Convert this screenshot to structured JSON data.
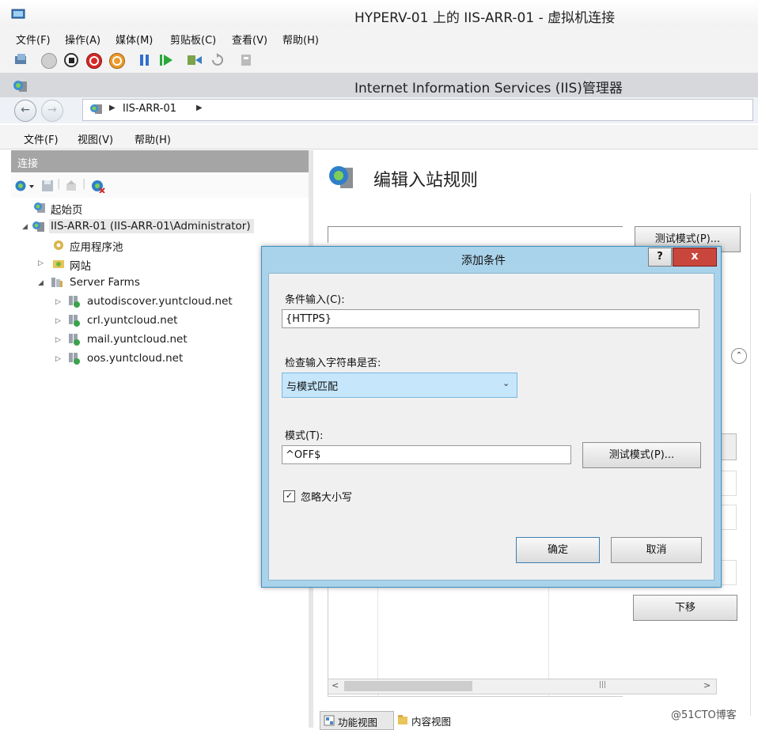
{
  "vm_window": {
    "title": "HYPERV-01 上的 IIS-ARR-01 - 虚拟机连接",
    "menu": [
      "文件(F)",
      "操作(A)",
      "媒体(M)",
      "剪贴板(C)",
      "查看(V)",
      "帮助(H)"
    ],
    "toolbar_icons": [
      "ctrl-alt-del-icon",
      "start-icon",
      "turn-off-icon",
      "shutdown-icon",
      "save-icon",
      "pause-icon",
      "resume-icon",
      "checkpoint-icon",
      "revert-icon",
      "enhanced-session-icon"
    ]
  },
  "iis": {
    "title": "Internet Information Services (IIS)管理器",
    "address": {
      "server": "IIS-ARR-01"
    },
    "menu": [
      "文件(F)",
      "视图(V)",
      "帮助(H)"
    ],
    "connections": {
      "header": "连接",
      "tree": [
        {
          "label": "起始页"
        },
        {
          "label": "IIS-ARR-01 (IIS-ARR-01\\Administrator)"
        },
        {
          "label": "应用程序池"
        },
        {
          "label": "网站"
        },
        {
          "label": "Server Farms"
        },
        {
          "label": "autodiscover.yuntcloud.net"
        },
        {
          "label": "crl.yuntcloud.net"
        },
        {
          "label": "mail.yuntcloud.net"
        },
        {
          "label": "oos.yuntcloud.net"
        }
      ]
    },
    "page": {
      "title": "编辑入站规则",
      "test_pattern_button": "测试模式(P)...",
      "move_down_button": "下移"
    },
    "bottom_tabs": [
      "功能视图",
      "内容视图"
    ]
  },
  "dialog": {
    "title": "添加条件",
    "help_label": "?",
    "close_label": "x",
    "condition_input_label": "条件输入(C):",
    "condition_input_value": "{HTTPS}",
    "check_label": "检查输入字符串是否:",
    "check_value": "与模式匹配",
    "pattern_label": "模式(T):",
    "pattern_value": "^OFF$",
    "test_button": "测试模式(P)...",
    "ignore_case_label": "忽略大小写",
    "ignore_case_checked": true,
    "ok_button": "确定",
    "cancel_button": "取消"
  },
  "watermark": "@51CTO博客",
  "colors": {
    "dialog_frame": "#a9d3ea",
    "close_button": "#c9463d",
    "selected_combo": "#c5e6fb"
  }
}
